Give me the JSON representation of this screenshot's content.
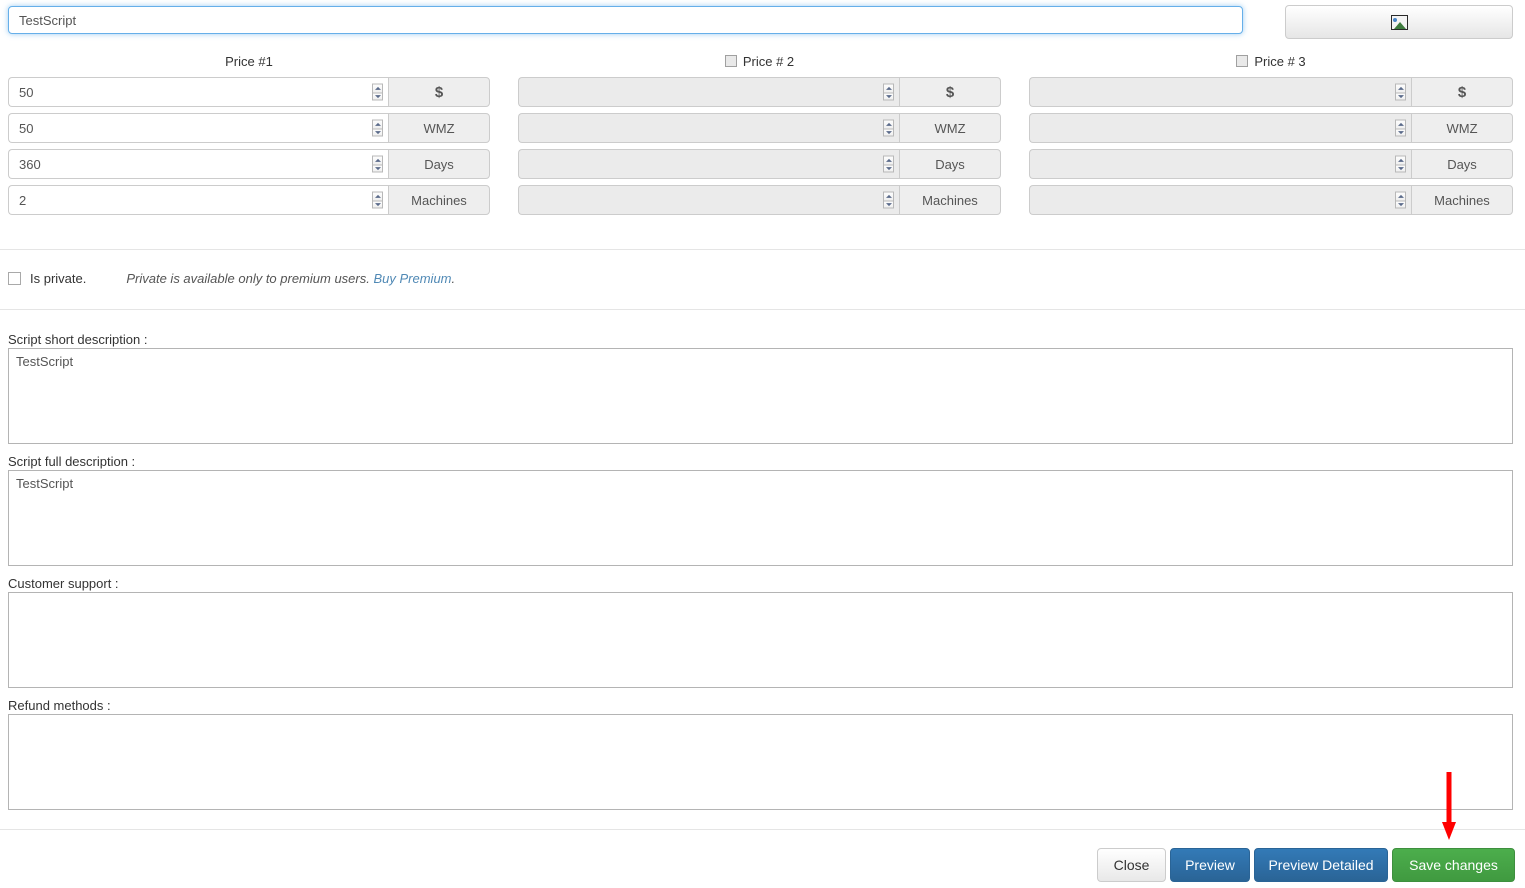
{
  "header": {
    "title_value": "TestScript",
    "title_placeholder": "",
    "image_button_icon": "image-icon",
    "image_button_label": ""
  },
  "prices": {
    "units": [
      "$",
      "WMZ",
      "Days",
      "Machines"
    ],
    "columns": [
      {
        "header": "Price #1",
        "has_checkbox": false,
        "checked": false,
        "enabled": true,
        "values": [
          "50",
          "50",
          "360",
          "2"
        ]
      },
      {
        "header": "Price # 2",
        "has_checkbox": true,
        "checked": false,
        "enabled": false,
        "values": [
          "",
          "",
          "",
          ""
        ]
      },
      {
        "header": "Price # 3",
        "has_checkbox": true,
        "checked": false,
        "enabled": false,
        "values": [
          "",
          "",
          "",
          ""
        ]
      }
    ]
  },
  "privacy": {
    "checkbox_label": "Is private.",
    "checked": false,
    "note": "Private is available only to premium users.",
    "link_text": "Buy Premium",
    "note_suffix": "."
  },
  "fields": [
    {
      "label": "Script short description :",
      "value": "TestScript",
      "placeholder": ""
    },
    {
      "label": "Script full description :",
      "value": "TestScript",
      "placeholder": ""
    },
    {
      "label": "Customer support :",
      "value": "",
      "placeholder": ""
    },
    {
      "label": "Refund methods :",
      "value": "",
      "placeholder": ""
    }
  ],
  "footer": {
    "close_label": "Close",
    "preview_label": "Preview",
    "preview_detailed_label": "Preview Detailed",
    "save_label": "Save changes"
  },
  "annotation": {
    "arrow_color": "#ff0000",
    "points_to": "save-changes-button"
  },
  "colors": {
    "primary": "#337ab7",
    "success": "#4cae4c",
    "link": "#5089b5",
    "focus_border": "#66afe9",
    "disabled_bg": "#ebebeb"
  }
}
